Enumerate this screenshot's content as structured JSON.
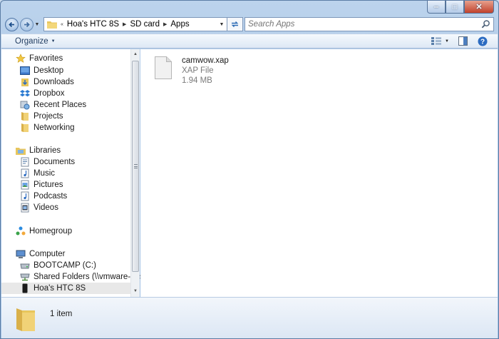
{
  "address": {
    "overflow": "«",
    "crumbs": [
      "Hoa's HTC 8S",
      "SD card",
      "Apps"
    ]
  },
  "search": {
    "placeholder": "Search Apps"
  },
  "toolbar": {
    "organize_label": "Organize"
  },
  "nav": {
    "favorites_label": "Favorites",
    "favorites": [
      "Desktop",
      "Downloads",
      "Dropbox",
      "Recent Places",
      "Projects",
      "Networking"
    ],
    "libraries_label": "Libraries",
    "libraries": [
      "Documents",
      "Music",
      "Pictures",
      "Podcasts",
      "Videos"
    ],
    "homegroup_label": "Homegroup",
    "computer_label": "Computer",
    "computer": [
      "BOOTCAMP (C:)",
      "Shared Folders (\\\\vmware-host) (Z:)",
      "Hoa's HTC 8S"
    ]
  },
  "files": [
    {
      "name": "camwow.xap",
      "type": "XAP File",
      "size": "1.94 MB"
    }
  ],
  "status": {
    "count": "1 item"
  },
  "colors": {
    "selection": "#e8e8e8",
    "chrome": "#a9c6e6",
    "folder": "#e8c65c"
  }
}
